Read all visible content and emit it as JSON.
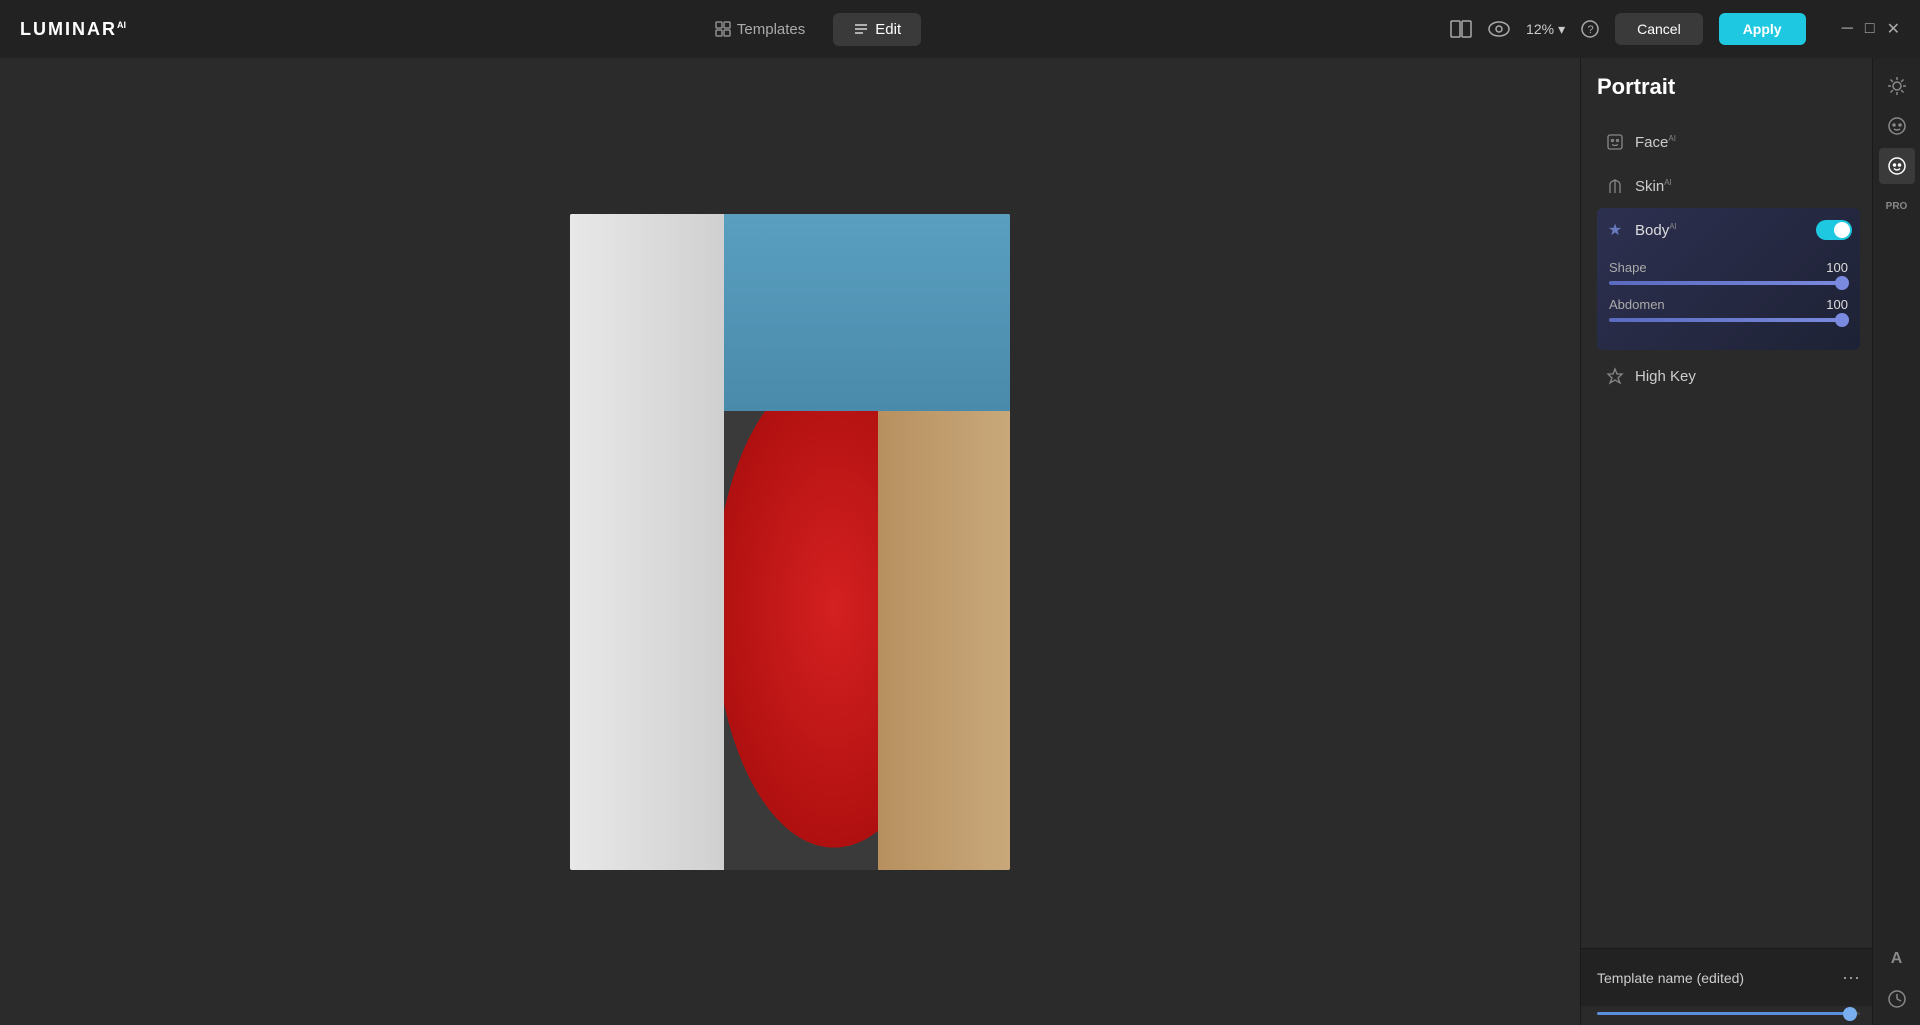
{
  "app": {
    "logo": "LUMINAR",
    "logo_sup": "AI"
  },
  "topbar": {
    "templates_label": "Templates",
    "edit_label": "Edit",
    "zoom_value": "12%",
    "cancel_label": "Cancel",
    "apply_label": "Apply"
  },
  "panel": {
    "title": "Portrait",
    "sections": [
      {
        "id": "face",
        "label": "Face",
        "sup": "AI"
      },
      {
        "id": "skin",
        "label": "Skin",
        "sup": "AI"
      },
      {
        "id": "body",
        "label": "Body",
        "sup": "AI",
        "expanded": true
      },
      {
        "id": "highkey",
        "label": "High Key",
        "sup": ""
      }
    ],
    "body": {
      "shape_label": "Shape",
      "shape_value": "100",
      "abdomen_label": "Abdomen",
      "abdomen_value": "100"
    }
  },
  "bottom": {
    "template_name": "Template name (edited)",
    "dots": "..."
  },
  "icons": {
    "templates": "⊞",
    "edit": "☰",
    "dual_screen": "⊟",
    "eye": "👁",
    "chevron_down": "▾",
    "help": "?",
    "minimize": "─",
    "maximize": "□",
    "close": "✕",
    "face": "☺",
    "skin": "✋",
    "body": "★",
    "highkey": "✦",
    "sun": "☀",
    "smiley": "☻",
    "text_tool": "A",
    "clock": "🕐",
    "toggle_on": true
  }
}
